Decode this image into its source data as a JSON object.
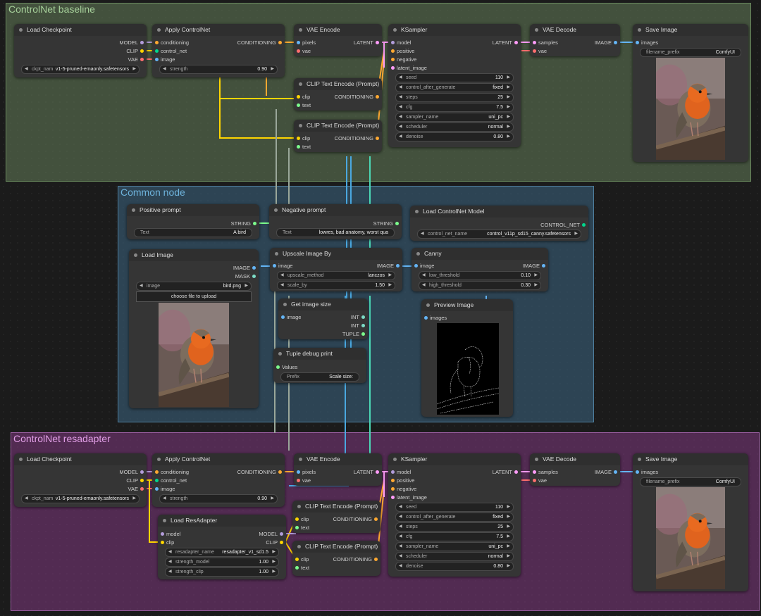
{
  "groups": {
    "top": {
      "title": "ControlNet baseline"
    },
    "middle": {
      "title": "Common node"
    },
    "bottom": {
      "title": "ControlNet resadapter"
    }
  },
  "colors": {
    "model": "#b39ddb",
    "clip": "#ffd500",
    "vae": "#ff6e6e",
    "conditioning": "#ffa931",
    "image": "#64b5f6",
    "latent": "#ff9cf9",
    "control_net": "#00d78d",
    "string": "#7cfc8c"
  },
  "top": {
    "load_checkpoint": {
      "title": "Load Checkpoint",
      "out_model": "MODEL",
      "out_clip": "CLIP",
      "out_vae": "VAE",
      "ckpt_label": "ckpt_nam",
      "ckpt_value": "v1-5-pruned-emaonly.safetensors"
    },
    "apply_controlnet": {
      "title": "Apply ControlNet",
      "in_conditioning": "conditioning",
      "in_control_net": "control_net",
      "in_image": "image",
      "out": "CONDITIONING",
      "strength_label": "strength",
      "strength_value": "0.90"
    },
    "vae_encode": {
      "title": "VAE Encode",
      "in_pixels": "pixels",
      "in_vae": "vae",
      "out": "LATENT"
    },
    "clip_text_1": {
      "title": "CLIP Text Encode (Prompt)",
      "in_clip": "clip",
      "in_text": "text",
      "out": "CONDITIONING"
    },
    "clip_text_2": {
      "title": "CLIP Text Encode (Prompt)",
      "in_clip": "clip",
      "in_text": "text",
      "out": "CONDITIONING"
    },
    "ksampler": {
      "title": "KSampler",
      "in_model": "model",
      "in_positive": "positive",
      "in_negative": "negative",
      "in_latent": "latent_image",
      "out": "LATENT",
      "widgets": [
        {
          "label": "seed",
          "value": "110"
        },
        {
          "label": "control_after_generate",
          "value": "fixed"
        },
        {
          "label": "steps",
          "value": "25"
        },
        {
          "label": "cfg",
          "value": "7.5"
        },
        {
          "label": "sampler_name",
          "value": "uni_pc"
        },
        {
          "label": "scheduler",
          "value": "normal"
        },
        {
          "label": "denoise",
          "value": "0.80"
        }
      ]
    },
    "vae_decode": {
      "title": "VAE Decode",
      "in_samples": "samples",
      "in_vae": "vae",
      "out": "IMAGE"
    },
    "save_image": {
      "title": "Save Image",
      "in_images": "images",
      "prefix_label": "filename_prefix",
      "prefix_value": "ComfyUI"
    }
  },
  "middle": {
    "positive_prompt": {
      "title": "Positive prompt",
      "out": "STRING",
      "text_label": "Text",
      "text_value": "A bird"
    },
    "negative_prompt": {
      "title": "Negative prompt",
      "out": "STRING",
      "text_label": "Text",
      "text_value": "lowres, bad anatomy, worst qua"
    },
    "load_controlnet_model": {
      "title": "Load ControlNet Model",
      "out": "CONTROL_NET",
      "name_label": "control_net_name",
      "name_value": "control_v11p_sd15_canny.safetensors"
    },
    "load_image": {
      "title": "Load Image",
      "out_image": "IMAGE",
      "out_mask": "MASK",
      "image_label": "image",
      "image_value": "bird.png",
      "upload_label": "choose file to upload"
    },
    "upscale_image": {
      "title": "Upscale Image By",
      "in_image": "image",
      "out": "IMAGE",
      "method_label": "upscale_method",
      "method_value": "lanczos",
      "scale_label": "scale_by",
      "scale_value": "1.50"
    },
    "canny": {
      "title": "Canny",
      "in_image": "image",
      "out": "IMAGE",
      "low_label": "low_threshold",
      "low_value": "0.10",
      "high_label": "high_threshold",
      "high_value": "0.30"
    },
    "get_size": {
      "title": "Get image size",
      "in_image": "image",
      "out_int1": "INT",
      "out_int2": "INT",
      "out_tuple": "TUPLE"
    },
    "preview_image": {
      "title": "Preview Image",
      "in_images": "images"
    },
    "tuple_print": {
      "title": "Tuple debug print",
      "in_values": "Values",
      "prefix_label": "Prefix",
      "prefix_value": "Scale size:"
    }
  },
  "bottom": {
    "load_checkpoint": {
      "title": "Load Checkpoint",
      "out_model": "MODEL",
      "out_clip": "CLIP",
      "out_vae": "VAE",
      "ckpt_label": "ckpt_nam",
      "ckpt_value": "v1-5-pruned-emaonly.safetensors"
    },
    "apply_controlnet": {
      "title": "Apply ControlNet",
      "in_conditioning": "conditioning",
      "in_control_net": "control_net",
      "in_image": "image",
      "out": "CONDITIONING",
      "strength_label": "strength",
      "strength_value": "0.90"
    },
    "load_resadapter": {
      "title": "Load ResAdapter",
      "in_model": "model",
      "in_clip": "clip",
      "out_model": "MODEL",
      "out_clip": "CLIP",
      "widgets": [
        {
          "label": "resadapter_name",
          "value": "resadapter_v1_sd1.5"
        },
        {
          "label": "strength_model",
          "value": "1.00"
        },
        {
          "label": "strength_clip",
          "value": "1.00"
        }
      ]
    },
    "vae_encode": {
      "title": "VAE Encode",
      "in_pixels": "pixels",
      "in_vae": "vae",
      "out": "LATENT"
    },
    "clip_text_1": {
      "title": "CLIP Text Encode (Prompt)",
      "in_clip": "clip",
      "in_text": "text",
      "out": "CONDITIONING"
    },
    "clip_text_2": {
      "title": "CLIP Text Encode (Prompt)",
      "in_clip": "clip",
      "in_text": "text",
      "out": "CONDITIONING"
    },
    "ksampler": {
      "title": "KSampler",
      "in_model": "model",
      "in_positive": "positive",
      "in_negative": "negative",
      "in_latent": "latent_image",
      "out": "LATENT",
      "widgets": [
        {
          "label": "seed",
          "value": "110"
        },
        {
          "label": "control_after_generate",
          "value": "fixed"
        },
        {
          "label": "steps",
          "value": "25"
        },
        {
          "label": "cfg",
          "value": "7.5"
        },
        {
          "label": "sampler_name",
          "value": "uni_pc"
        },
        {
          "label": "scheduler",
          "value": "normal"
        },
        {
          "label": "denoise",
          "value": "0.80"
        }
      ]
    },
    "vae_decode": {
      "title": "VAE Decode",
      "in_samples": "samples",
      "in_vae": "vae",
      "out": "IMAGE"
    },
    "save_image": {
      "title": "Save Image",
      "in_images": "images",
      "prefix_label": "filename_prefix",
      "prefix_value": "ComfyUI"
    }
  }
}
